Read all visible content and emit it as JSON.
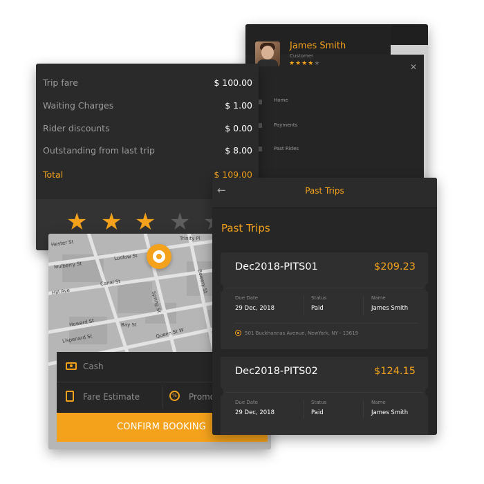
{
  "colors": {
    "accent": "#f4a21b",
    "panel": "#2a2a2a",
    "background": "#ffffff"
  },
  "profile": {
    "name": "James Smith",
    "role": "Customer",
    "rating": 4,
    "rating_max": 5,
    "menu": [
      {
        "label": "Home",
        "icon": "home-icon"
      },
      {
        "label": "Payments",
        "icon": "wallet-icon"
      },
      {
        "label": "Past Rides",
        "icon": "history-icon"
      }
    ],
    "close_icon": "close-icon"
  },
  "fare": {
    "rows": [
      {
        "label": "Trip fare",
        "value": "$ 100.00"
      },
      {
        "label": "Waiting Charges",
        "value": "$ 1.00"
      },
      {
        "label": "Rider discounts",
        "value": "$ 0.00"
      },
      {
        "label": "Outstanding from last trip",
        "value": "$ 8.00"
      }
    ],
    "total": {
      "label": "Total",
      "value": "$ 109.00"
    },
    "rating": 3,
    "rating_max": 5
  },
  "booking": {
    "streets": {
      "s1": "Hester St",
      "s2": "Trinity Pl",
      "s3": "Ludlow St",
      "s4": "Mulberry St",
      "s5": "Canal St",
      "s6": "Bowery St",
      "s7": "Hill Ave",
      "s8": "Queen St W",
      "s9": "Bay St",
      "s10": "Howard St",
      "s11": "Spring St",
      "s12": "Lispenard St"
    },
    "cash_label": "Cash",
    "fare_estimate_label": "Fare Estimate",
    "promo_label": "Promo",
    "confirm_label": "CONFIRM BOOKING"
  },
  "trips": {
    "header_title": "Past Trips",
    "section_title": "Past Trips",
    "labels": {
      "due_date": "Due Date",
      "status": "Status",
      "name": "Name"
    },
    "items": [
      {
        "id": "Dec2018-PITS01",
        "amount": "$209.23",
        "due_date": "29 Dec, 2018",
        "status": "Paid",
        "name": "James Smith",
        "address": "501 Buckhannas Avenue, NewYork, NY - 13619"
      },
      {
        "id": "Dec2018-PITS02",
        "amount": "$124.15",
        "due_date": "29 Dec, 2018",
        "status": "Paid",
        "name": "James Smith"
      }
    ]
  }
}
